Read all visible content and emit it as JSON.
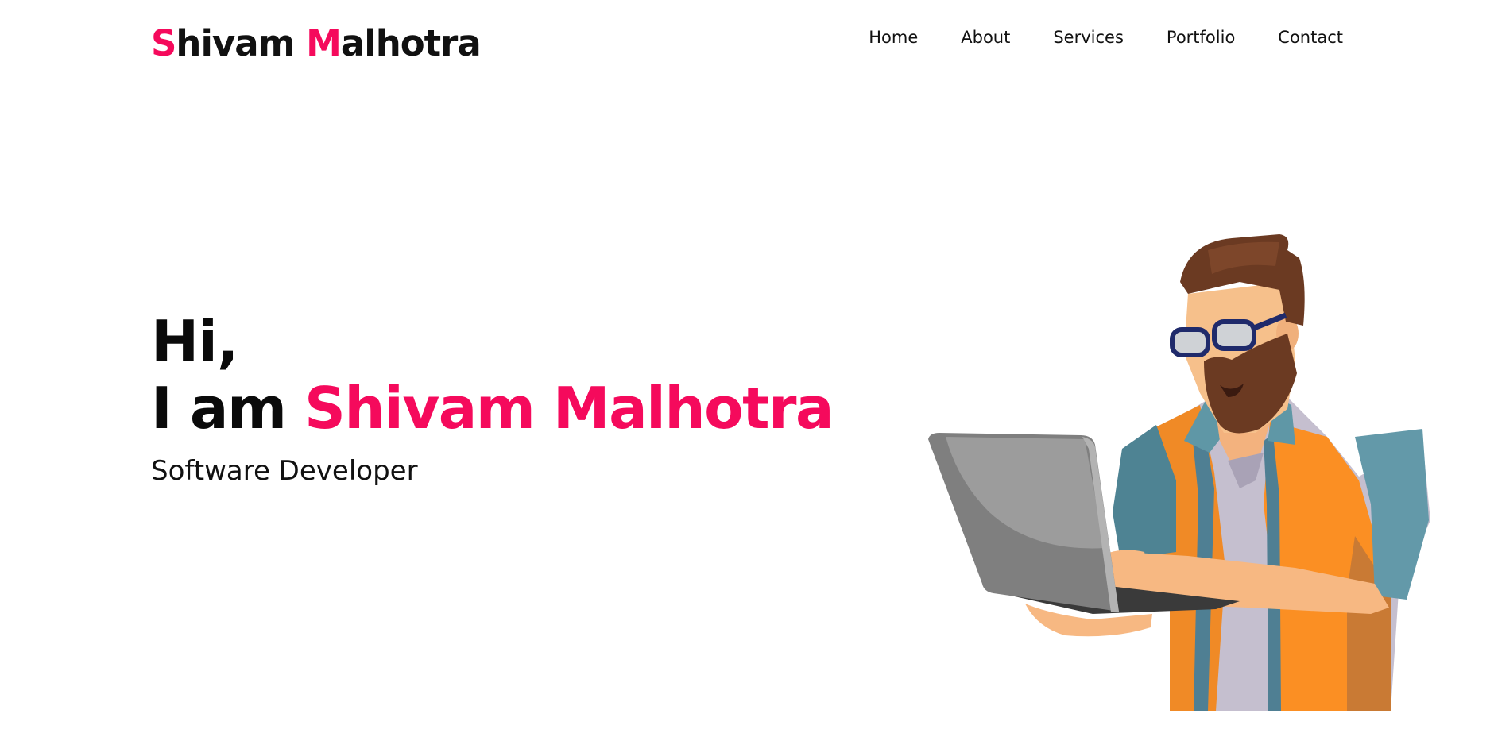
{
  "header": {
    "logo": {
      "first_initial": "S",
      "first_rest": "hivam ",
      "last_initial": "M",
      "last_rest": "alhotra"
    },
    "nav": {
      "home": "Home",
      "about": "About",
      "services": "Services",
      "portfolio": "Portfolio",
      "contact": "Contact"
    }
  },
  "hero": {
    "greeting": "Hi,",
    "intro_prefix": "I am ",
    "name": "Shivam Malhotra",
    "role": "Software Developer"
  },
  "colors": {
    "accent": "#f50a5c",
    "text": "#111111",
    "background": "#ffffff"
  },
  "icons": {
    "illustration": "developer-with-laptop-illustration"
  }
}
